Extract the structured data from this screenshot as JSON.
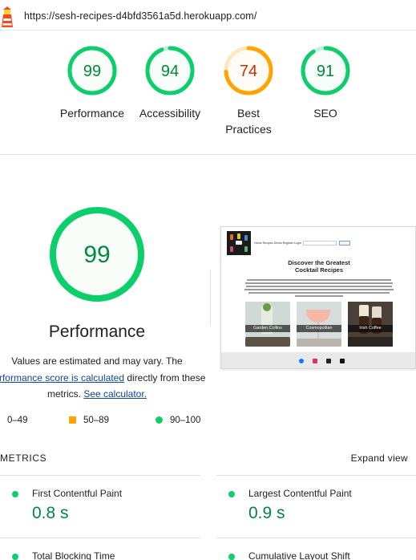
{
  "url_bar": {
    "url": "https://sesh-recipes-d4bfd3561a5d.herokuapp.com/"
  },
  "colors": {
    "pass": "#0cce6b",
    "pass_fill": "#e7faee",
    "pass_text": "#008a3e",
    "average": "#ffa400",
    "average_fill": "#fff3e0",
    "average_text": "#c33300",
    "metric_value": "#018642"
  },
  "gauges": [
    {
      "score": 99,
      "label_line1": "Performance",
      "label_line2": "",
      "rating": "pass"
    },
    {
      "score": 94,
      "label_line1": "Accessibility",
      "label_line2": "",
      "rating": "pass"
    },
    {
      "score": 74,
      "label_line1": "Best",
      "label_line2": "Practices",
      "rating": "average"
    },
    {
      "score": 91,
      "label_line1": "SEO",
      "label_line2": "",
      "rating": "pass"
    }
  ],
  "performance": {
    "score": 99,
    "title": "Performance",
    "desc_1": "Values are estimated and may vary. The",
    "desc_link": "performance score is calculated",
    "desc_2": " directly from these metrics. ",
    "desc_calc": "See calculator."
  },
  "legend": {
    "fail": "0–49",
    "average": "50–89",
    "pass": "90–100"
  },
  "screenshot": {
    "nav_text": "Home  Recipes  Drinks  Register  Login",
    "heading_1": "Discover the Greatest",
    "heading_2": "Cocktail Recipes",
    "cards": [
      "Garden Collins",
      "Cosmopolitan",
      "Irish Coffee"
    ]
  },
  "metrics": {
    "title": "METRICS",
    "expand_label": "Expand view",
    "items": [
      {
        "name": "First Contentful Paint",
        "value": "0.8 s"
      },
      {
        "name": "Largest Contentful Paint",
        "value": "0.9 s"
      },
      {
        "name": "Total Blocking Time",
        "value": ""
      },
      {
        "name": "Cumulative Layout Shift",
        "value": ""
      }
    ]
  }
}
